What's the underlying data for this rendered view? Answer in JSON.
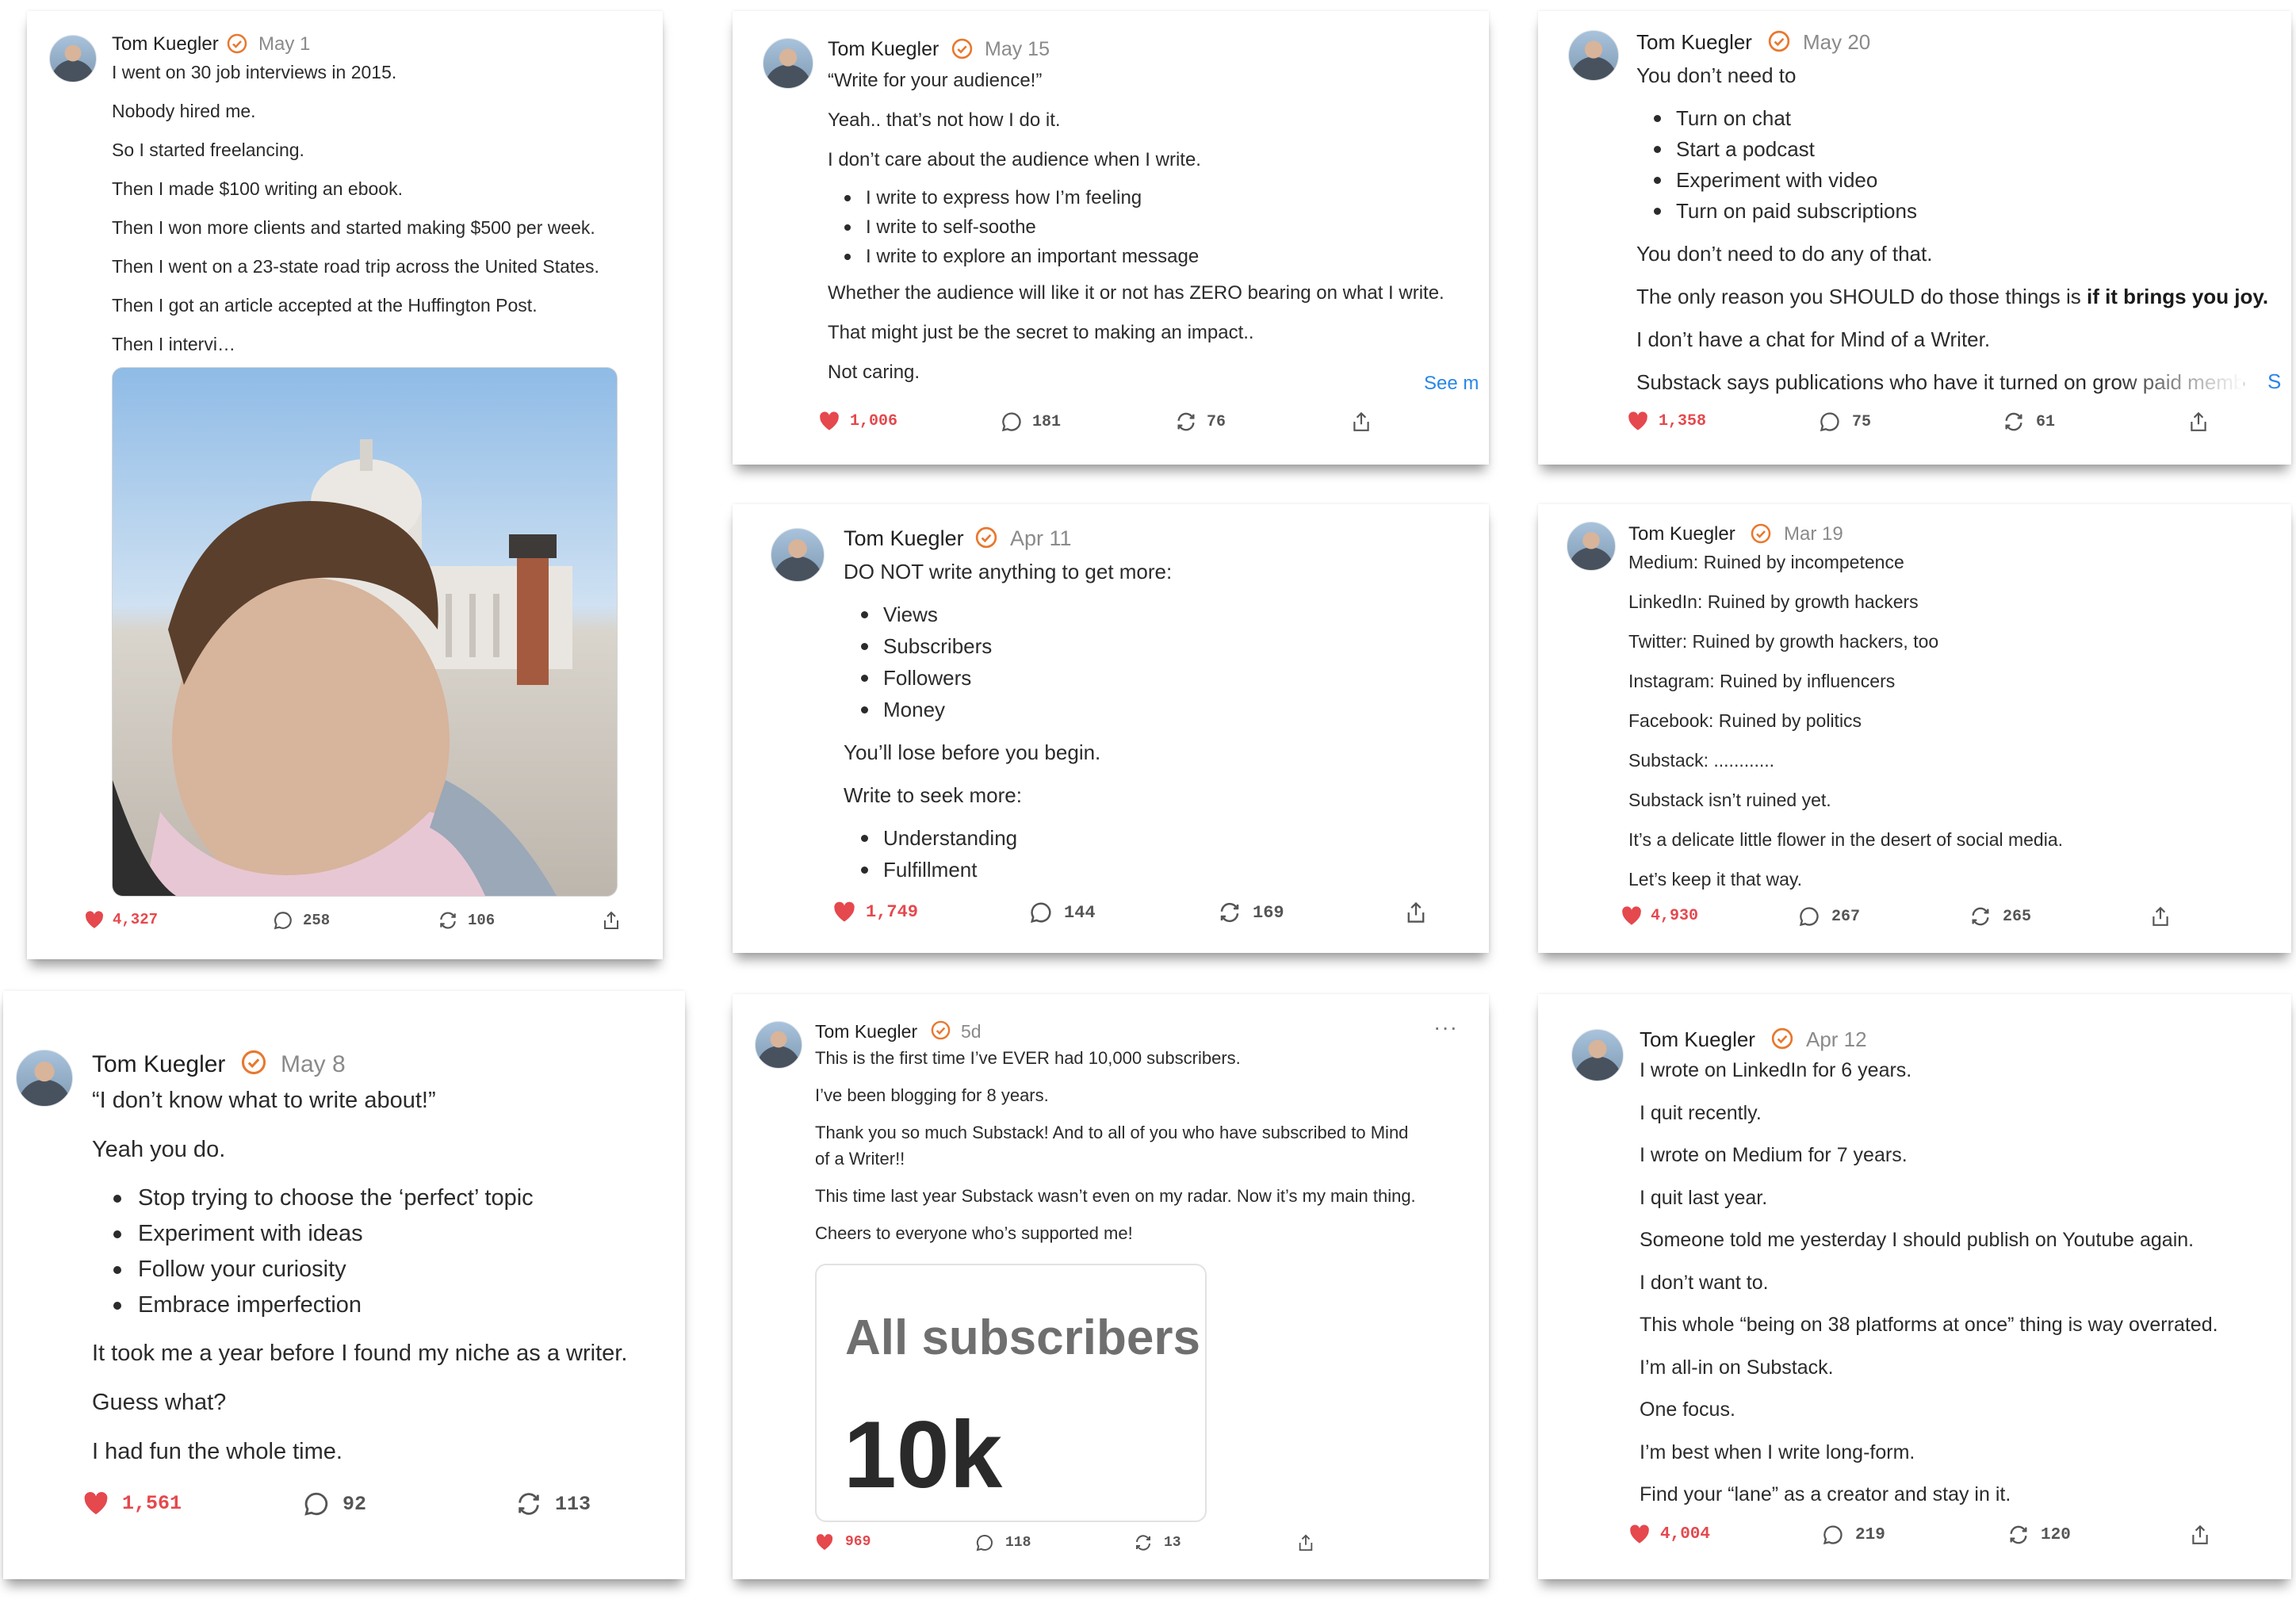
{
  "author": "Tom Kuegler",
  "accent": "#e8782e",
  "like_color": "#e5484d",
  "link_color": "#2a86e8",
  "posts": {
    "p1": {
      "date": "May 1",
      "paras": [
        "I went on 30 job interviews in 2015.",
        "Nobody hired me.",
        "So I started freelancing.",
        "Then I made $100 writing an ebook.",
        "Then I won more clients and started making $500 per week.",
        "Then I went on a 23-state road trip across the United States.",
        "Then I got an article accepted at the Huffington Post.",
        "Then I intervi…"
      ],
      "photo_icon": "selfie-capitol-photo",
      "likes": "4,327",
      "comments": "258",
      "restacks": "106"
    },
    "p2": {
      "date": "May 15",
      "p_top": [
        "“Write for your audience!”",
        "Yeah.. that’s not how I do it.",
        "I don’t care about the audience when I write."
      ],
      "bullets": [
        "I write to express how I’m feeling",
        "I write to self-soothe",
        "I write to explore an important message"
      ],
      "p_bottom": [
        "Whether the audience will like it or not has ZERO bearing on what I write.",
        "That might just be the secret to making an impact..",
        "Not caring."
      ],
      "see_more": "See m",
      "likes": "1,006",
      "comments": "181",
      "restacks": "76"
    },
    "p3": {
      "date": "May 20",
      "p_top": [
        "You don’t need to"
      ],
      "bullets": [
        "Turn on chat",
        "Start a podcast",
        "Experiment with video",
        "Turn on paid subscriptions"
      ],
      "p_mid": "You don’t need to do any of that.",
      "p_reason": "The only reason you SHOULD do those things is ",
      "p_reason_bold": "if it brings you joy.",
      "p_chat": "I don’t have a chat for Mind of a Writer.",
      "p_cut": "Substack says publications who have it turned on grow paid memb",
      "see_more": "S",
      "likes": "1,358",
      "comments": "75",
      "restacks": "61"
    },
    "p4": {
      "date": "Apr 11",
      "p_top": [
        "DO NOT write anything to get more:"
      ],
      "bullets1": [
        "Views",
        "Subscribers",
        "Followers",
        "Money"
      ],
      "p_mid": [
        "You’ll lose before you begin.",
        "Write to seek more:"
      ],
      "bullets2": [
        "Understanding",
        "Fulfillment"
      ],
      "likes": "1,749",
      "comments": "144",
      "restacks": "169"
    },
    "p5": {
      "date": "Mar 19",
      "paras": [
        "Medium: Ruined by incompetence",
        "LinkedIn: Ruined by growth hackers",
        "Twitter: Ruined by growth hackers, too",
        "Instagram: Ruined by influencers",
        "Facebook: Ruined by politics",
        "Substack: ............",
        "Substack isn’t ruined yet.",
        "It’s a delicate little flower in the desert of social media.",
        "Let’s keep it that way."
      ],
      "likes": "4,930",
      "comments": "267",
      "restacks": "265"
    },
    "p6": {
      "date": "May 8",
      "p_top": [
        "“I don’t know what to write about!”",
        "Yeah you do."
      ],
      "bullets": [
        "Stop trying to choose the ‘perfect’ topic",
        "Experiment with ideas",
        "Follow your curiosity",
        "Embrace imperfection"
      ],
      "p_bottom": [
        "It took me a year before I found my niche as a writer.",
        "Guess what?",
        "I had fun the whole time."
      ],
      "likes": "1,561",
      "comments": "92",
      "restacks": "113"
    },
    "p7": {
      "date": "5d",
      "paras": [
        "This is the first time I’ve EVER had 10,000 subscribers.",
        "I’ve been blogging for 8 years.",
        "Thank you so much Substack! And to all of you who have subscribed to Mind",
        "of a Writer!!",
        "This time last year Substack wasn’t even on my radar. Now it’s my main thing.",
        "Cheers to everyone who’s supported me!"
      ],
      "box_title": "All subscribers",
      "box_value": "10k",
      "more": "···",
      "likes": "969",
      "comments": "118",
      "restacks": "13"
    },
    "p8": {
      "date": "Apr 12",
      "paras": [
        "I wrote on LinkedIn for 6 years.",
        "I quit recently.",
        "I wrote on Medium for 7 years.",
        "I quit last year.",
        "Someone told me yesterday I should publish on Youtube again.",
        "I don’t want to.",
        "This whole “being on 38 platforms at once” thing is way overrated.",
        "I’m all-in on Substack.",
        "One focus.",
        "I’m best when I write long-form.",
        "Find your “lane” as a creator and stay in it."
      ],
      "likes": "4,004",
      "comments": "219",
      "restacks": "120"
    }
  }
}
